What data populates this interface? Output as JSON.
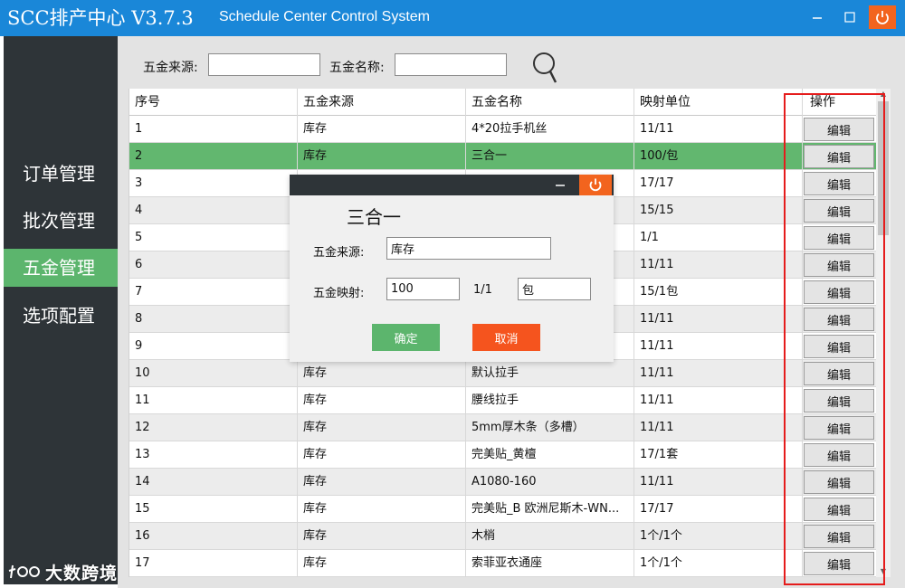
{
  "window": {
    "title": "SCC排产中心 V3.7.3",
    "subtitle": "Schedule Center Control System",
    "minimize_icon": "minimize-icon",
    "maximize_icon": "maximize-icon",
    "close_icon": "power-icon",
    "titlebar_color": "#1a87d8",
    "close_color": "#f2641e"
  },
  "sidebar": {
    "items": [
      {
        "label": "订单管理",
        "active": false
      },
      {
        "label": "批次管理",
        "active": false
      },
      {
        "label": "五金管理",
        "active": true
      },
      {
        "label": "选项配置",
        "active": false
      }
    ],
    "active_color": "#5cb56d",
    "background": "#2e3438"
  },
  "search": {
    "source_label": "五金来源:",
    "source_value": "",
    "name_label": "五金名称:",
    "name_value": "",
    "icon": "search-icon"
  },
  "table": {
    "columns": [
      "序号",
      "五金来源",
      "五金名称",
      "映射单位",
      "操作"
    ],
    "rows": [
      {
        "no": "1",
        "source": "库存",
        "name": "4*20拉手机丝",
        "unit": "11/11",
        "action": "编辑"
      },
      {
        "no": "2",
        "source": "库存",
        "name": "三合一",
        "unit": "100/包",
        "action": "编辑",
        "selected": true
      },
      {
        "no": "3",
        "source": "",
        "name": "",
        "unit": "17/17",
        "action": "编辑"
      },
      {
        "no": "4",
        "source": "",
        "name": "",
        "unit": "15/15",
        "action": "编辑"
      },
      {
        "no": "5",
        "source": "",
        "name": "",
        "unit": "1/1",
        "action": "编辑"
      },
      {
        "no": "6",
        "source": "",
        "name": "",
        "unit": "11/11",
        "action": "编辑"
      },
      {
        "no": "7",
        "source": "",
        "name": "",
        "unit": "15/1包",
        "action": "编辑"
      },
      {
        "no": "8",
        "source": "",
        "name": "",
        "unit": "11/11",
        "action": "编辑"
      },
      {
        "no": "9",
        "source": "",
        "name": "",
        "unit": "11/11",
        "action": "编辑"
      },
      {
        "no": "10",
        "source": "库存",
        "name": "默认拉手",
        "unit": "11/11",
        "action": "编辑"
      },
      {
        "no": "11",
        "source": "库存",
        "name": "腰线拉手",
        "unit": "11/11",
        "action": "编辑"
      },
      {
        "no": "12",
        "source": "库存",
        "name": "5mm厚木条（多槽）",
        "unit": "11/11",
        "action": "编辑"
      },
      {
        "no": "13",
        "source": "库存",
        "name": "完美贴_黄檀",
        "unit": "17/1套",
        "action": "编辑"
      },
      {
        "no": "14",
        "source": "库存",
        "name": "A1080-160",
        "unit": "11/11",
        "action": "编辑"
      },
      {
        "no": "15",
        "source": "库存",
        "name": "完美贴_B 欧洲尼斯木-WN...",
        "unit": "17/17",
        "action": "编辑"
      },
      {
        "no": "16",
        "source": "库存",
        "name": "木梢",
        "unit": "1个/1个",
        "action": "编辑"
      },
      {
        "no": "17",
        "source": "库存",
        "name": "索菲亚衣通座",
        "unit": "1个/1个",
        "action": "编辑"
      }
    ],
    "selected_color": "#62b76f"
  },
  "dialog": {
    "title": "三合一",
    "source_label": "五金来源:",
    "source_value": "库存",
    "mapping_label": "五金映射:",
    "mapping_value": "100",
    "ratio_text": "1/1",
    "unit_value": "包",
    "ok_label": "确定",
    "cancel_label": "取消",
    "ok_color": "#5cb56d",
    "cancel_color": "#f5541e"
  },
  "watermark": {
    "text": "大数跨境",
    "logo": "brand-logo-icon"
  }
}
